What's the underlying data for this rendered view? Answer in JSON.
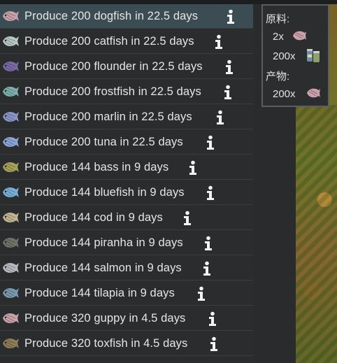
{
  "menu": {
    "options": [
      {
        "label": "Produce 200 dogfish in 22.5 days",
        "fish": "dogfish",
        "color": "#c9a2aa"
      },
      {
        "label": "Produce 200 catfish in 22.5 days",
        "fish": "catfish",
        "color": "#b8c9c4"
      },
      {
        "label": "Produce 200 flounder in 22.5 days",
        "fish": "flounder",
        "color": "#7a6aa8"
      },
      {
        "label": "Produce 200 frostfish in 22.5 days",
        "fish": "frostfish",
        "color": "#7fb0ae"
      },
      {
        "label": "Produce 200 marlin in 22.5 days",
        "fish": "marlin",
        "color": "#8a96c8"
      },
      {
        "label": "Produce 200 tuna in 22.5 days",
        "fish": "tuna",
        "color": "#8aa6d6"
      },
      {
        "label": "Produce 144 bass in 9 days",
        "fish": "bass",
        "color": "#a6a35a"
      },
      {
        "label": "Produce 144 bluefish in 9 days",
        "fish": "bluefish",
        "color": "#7ab0d8"
      },
      {
        "label": "Produce 144 cod in 9 days",
        "fish": "cod",
        "color": "#c2b591"
      },
      {
        "label": "Produce 144 piranha in 9 days",
        "fish": "piranha",
        "color": "#6e7466"
      },
      {
        "label": "Produce 144 salmon in 9 days",
        "fish": "salmon",
        "color": "#b9b9c2"
      },
      {
        "label": "Produce 144 tilapia in 9 days",
        "fish": "tilapia",
        "color": "#7a98ae"
      },
      {
        "label": "Produce 320 guppy in 4.5 days",
        "fish": "guppy",
        "color": "#c9a2aa"
      },
      {
        "label": "Produce 320 toxfish in 4.5 days",
        "fish": "toxfish",
        "color": "#8f7d5a"
      }
    ]
  },
  "tooltip": {
    "ingredients_header": "原料:",
    "ingredients": [
      {
        "qty": "2x",
        "icon": "dogfish-icon"
      },
      {
        "qty": "200x",
        "icon": "fish-food-icon"
      }
    ],
    "products_header": "产物:",
    "products": [
      {
        "qty": "200x",
        "icon": "dogfish-icon"
      }
    ]
  },
  "colors": {
    "menu_bg": "#2b2c2d",
    "hover_bg": "#3b4d52",
    "text": "#e6e6e6"
  }
}
